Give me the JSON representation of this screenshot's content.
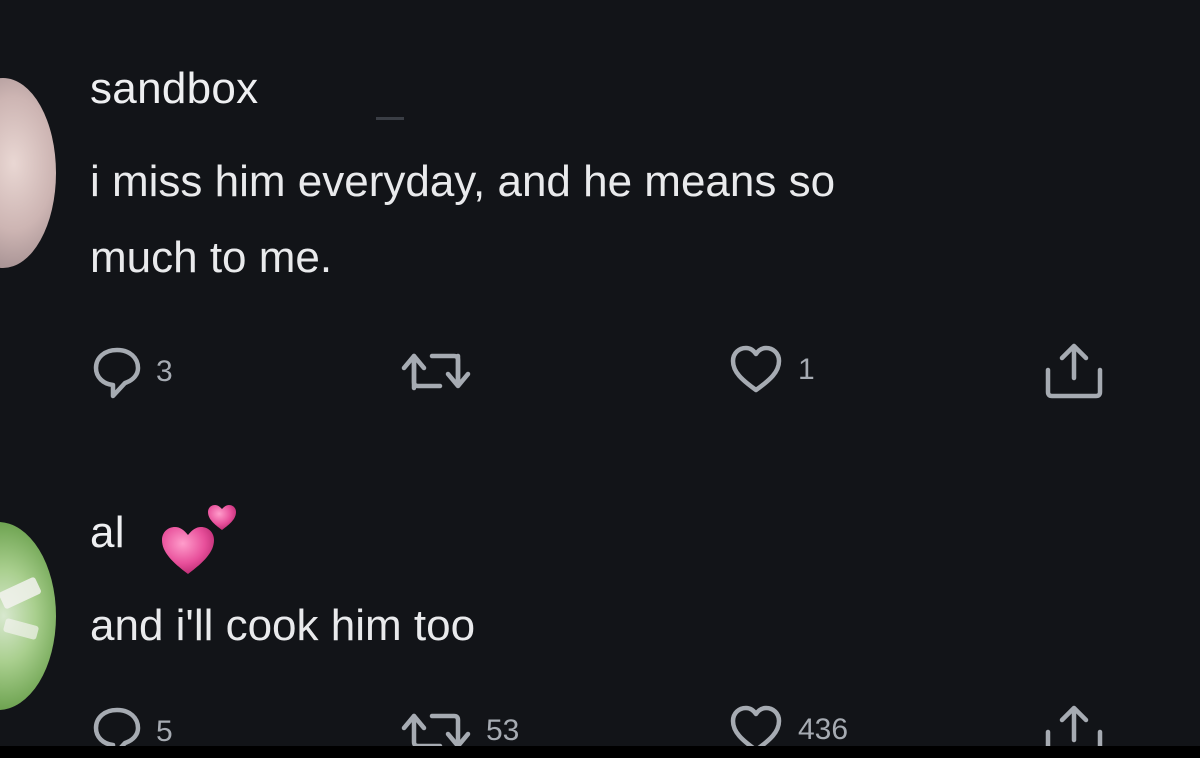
{
  "tweets": [
    {
      "username": "sandbox",
      "text_lines": [
        "i miss him everyday, and he means so",
        "much to me."
      ],
      "reply_count": "3",
      "retweet_count": "",
      "like_count": "1"
    },
    {
      "username": "al",
      "emoji": "two-hearts",
      "text_lines": [
        "and i'll cook him too"
      ],
      "reply_count": "5",
      "retweet_count": "53",
      "like_count": "436"
    }
  ],
  "colors": {
    "background": "#121418",
    "text": "#e9eaec",
    "icon": "#a6abb2",
    "heart_emoji": "#e8509b"
  },
  "icons": [
    "reply-icon",
    "retweet-icon",
    "like-icon",
    "share-icon"
  ]
}
